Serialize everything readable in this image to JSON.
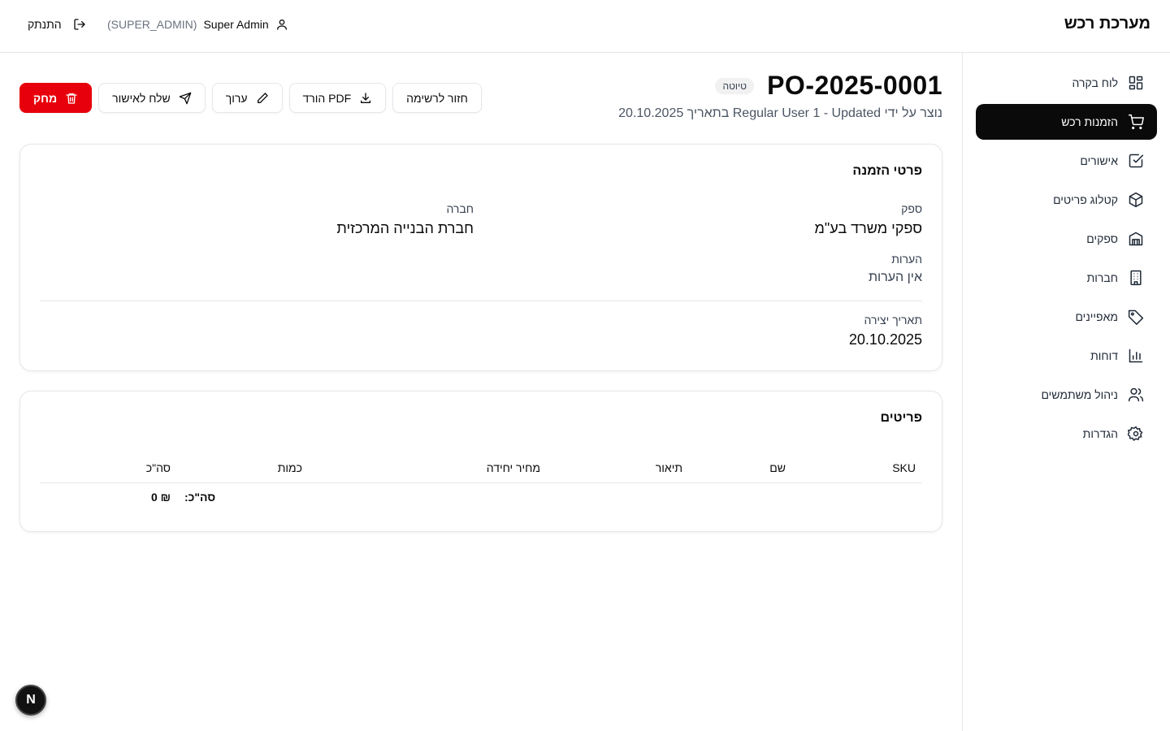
{
  "header": {
    "brand": "מערכת רכש",
    "user_name": "Super Admin",
    "user_role": "(SUPER_ADMIN)",
    "logout_label": "התנתק"
  },
  "sidebar": {
    "items": [
      {
        "label": "לוח בקרה",
        "icon": "dashboard-icon",
        "active": false
      },
      {
        "label": "הזמנות רכש",
        "icon": "shopping-cart-icon",
        "active": true
      },
      {
        "label": "אישורים",
        "icon": "check-square-icon",
        "active": false
      },
      {
        "label": "קטלוג פריטים",
        "icon": "package-icon",
        "active": false
      },
      {
        "label": "ספקים",
        "icon": "warehouse-icon",
        "active": false
      },
      {
        "label": "חברות",
        "icon": "building-icon",
        "active": false
      },
      {
        "label": "מאפיינים",
        "icon": "tag-icon",
        "active": false
      },
      {
        "label": "דוחות",
        "icon": "bar-chart-icon",
        "active": false
      },
      {
        "label": "ניהול משתמשים",
        "icon": "users-icon",
        "active": false
      },
      {
        "label": "הגדרות",
        "icon": "gear-icon",
        "active": false
      }
    ]
  },
  "po": {
    "number": "PO-2025-0001",
    "status": "טיוטה",
    "created_line": "נוצר על ידי Regular User 1 - Updated בתאריך 20.10.2025"
  },
  "actions": {
    "back": "חזור לרשימה",
    "pdf": "הורד PDF",
    "edit": "ערוך",
    "send": "שלח לאישור",
    "delete": "מחק"
  },
  "details": {
    "title": "פרטי הזמנה",
    "supplier_label": "ספק",
    "supplier_value": "ספקי משרד בע\"מ",
    "company_label": "חברה",
    "company_value": "חברת הבנייה המרכזית",
    "notes_label": "הערות",
    "notes_value": "אין הערות",
    "created_label": "תאריך יצירה",
    "created_value": "20.10.2025"
  },
  "items": {
    "title": "פריטים",
    "columns": [
      "SKU",
      "שם",
      "תיאור",
      "מחיר יחידה",
      "כמות",
      "סה\"כ"
    ],
    "total_label": "סה\"כ:",
    "total_value": "₪ 0"
  },
  "colors": {
    "accent": "#0a0a0a",
    "danger": "#e7000b",
    "border": "#e5e7eb"
  }
}
